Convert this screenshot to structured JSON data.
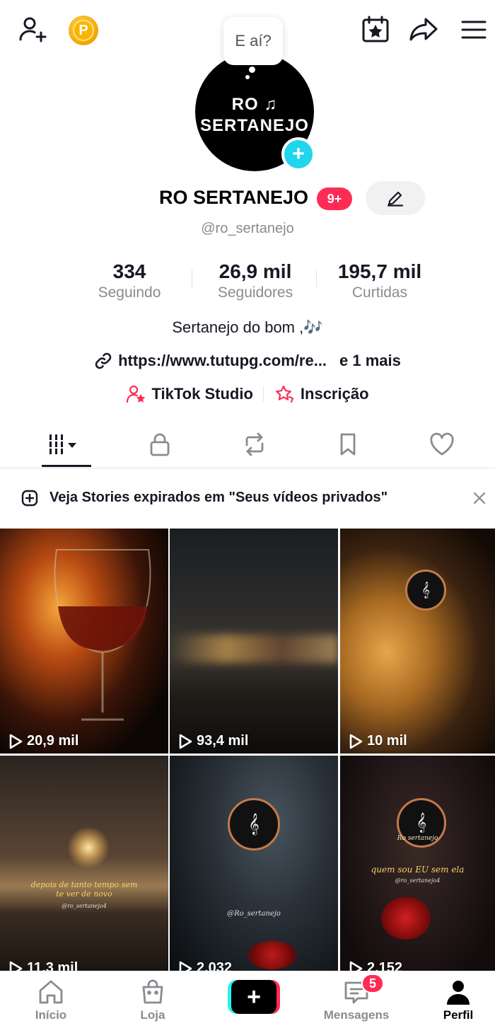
{
  "topbar": {
    "add_friend_icon": "person-plus-icon",
    "coin_letter": "P"
  },
  "profile": {
    "speech_bubble": "E aí?",
    "avatar_line1": "RO",
    "avatar_line2": "SERTANEJO",
    "name": "RO SERTANEJO",
    "badge": "9+",
    "handle": "@ro_sertanejo"
  },
  "stats": [
    {
      "value": "334",
      "label": "Seguindo"
    },
    {
      "value": "26,9 mil",
      "label": "Seguidores"
    },
    {
      "value": "195,7 mil",
      "label": "Curtidas"
    }
  ],
  "bio": "Sertanejo do bom ,🎶",
  "link": {
    "url": "https://www.tutupg.com/re...",
    "more": "e 1 mais"
  },
  "shortcuts": [
    {
      "label": "TikTok Studio",
      "icon": "person-star-icon"
    },
    {
      "label": "Inscrição",
      "icon": "star-link-icon"
    }
  ],
  "notice": "Veja Stories expirados em \"Seus vídeos privados\"",
  "videos": [
    {
      "views": "20,9 mil"
    },
    {
      "views": "93,4 mil"
    },
    {
      "views": "10 mil"
    },
    {
      "views": "11,3 mil",
      "caption": "depois de tanto tempo sem te ver de novo",
      "watermark": "@ro_sertanejo4"
    },
    {
      "views": "2.032",
      "watermark": "@Ro_sertanejo"
    },
    {
      "views": "2.152",
      "caption": "quem sou EU sem ela",
      "watermark": "@ro_sertanejo4",
      "logo_text": "Ro sertanejo"
    }
  ],
  "nav": {
    "home": "Início",
    "shop": "Loja",
    "messages": "Mensagens",
    "messages_badge": "5",
    "profile": "Perfil"
  },
  "colors": {
    "accent": "#fe2c55",
    "cyan": "#25f4ee",
    "plus_blue": "#20d5ec"
  }
}
